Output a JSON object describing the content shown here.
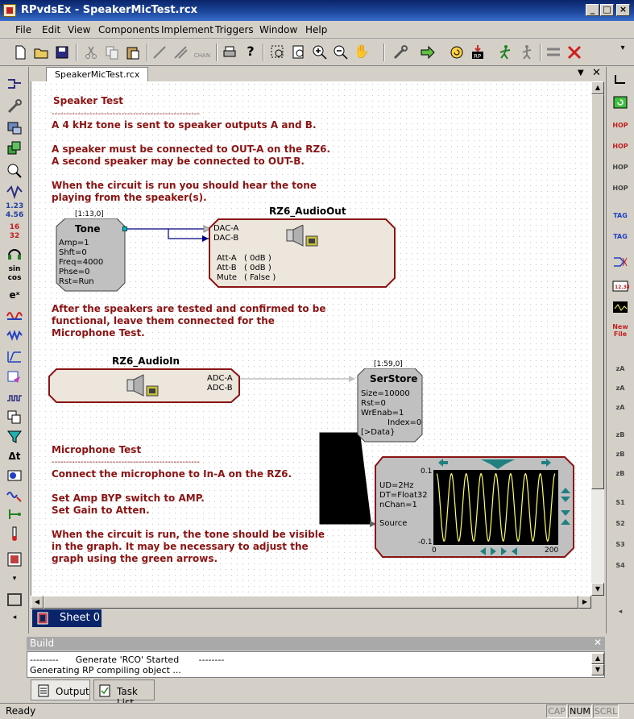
{
  "window": {
    "title": "RPvdsEx - SpeakerMicTest.rcx"
  },
  "menu": [
    "File",
    "Edit",
    "View",
    "Components",
    "Implement",
    "Triggers",
    "Window",
    "Help"
  ],
  "doc_tab": "SpeakerMicTest.rcx",
  "sheet_tab": "Sheet 0",
  "notes": {
    "speaker_title": "Speaker Test",
    "speaker_rule": "---------------------------------------------------",
    "speaker_l1": "A 4 kHz tone is sent to speaker outputs A and B.",
    "speaker_l2": "A speaker must be connected to OUT-A on the RZ6.",
    "speaker_l3": "A second speaker may be connected to OUT-B.",
    "speaker_l4": "When the circuit is run you should hear the tone",
    "speaker_l5": "playing from the speaker(s).",
    "after_l1": "After the speakers are tested and confirmed to be",
    "after_l2": "functional, leave them connected for the",
    "after_l3": "Microphone Test.",
    "mic_title": "Microphone Test",
    "mic_rule": "---------------------------------------------------",
    "mic_l1": "Connect the microphone to In-A on the RZ6.",
    "mic_l2": "Set Amp BYP switch  to AMP.",
    "mic_l3": "Set Gain to Atten.",
    "mic_l4": "When the circuit is run, the tone should be visible",
    "mic_l5": "in the graph. It may be necessary to adjust the",
    "mic_l6": "graph using the green arrows."
  },
  "tone": {
    "index": "[1:13,0]",
    "title": "Tone",
    "params": [
      "Amp=1",
      "Shft=0",
      "Freq=4000",
      "Phse=0",
      "Rst=Run"
    ]
  },
  "audio_out": {
    "title": "RZ6_AudioOut",
    "inputs": [
      "DAC-A",
      "DAC-B"
    ],
    "att_a": "Att-A",
    "att_a_val": "( 0dB )",
    "att_b": "Att-B",
    "att_b_val": "( 0dB )",
    "mute": "Mute",
    "mute_val": "( False )"
  },
  "audio_in": {
    "title": "RZ6_AudioIn",
    "outputs": [
      "ADC-A",
      "ADC-B"
    ]
  },
  "serstore": {
    "index": "[1:59,0]",
    "title": "SerStore",
    "params": [
      "Size=10000",
      "Rst=0",
      "WrEnab=1"
    ],
    "index_out": "Index=0",
    "data_in": "[>Data}"
  },
  "graph": {
    "params": [
      "UD=2Hz",
      "DT=Float32",
      "nChan=1"
    ],
    "source": "Source",
    "y_top": "0.1",
    "y_bottom": "-0.1",
    "x_left": "0",
    "x_right": "200"
  },
  "build": {
    "header": "Build",
    "lines": [
      "---------      Generate 'RCO' Started       --------",
      "Generating RP compiling object ..."
    ],
    "tabs": [
      "Output",
      "Task List"
    ]
  },
  "status": {
    "text": "Ready",
    "panels": [
      "CAP",
      "NUM",
      "SCRL"
    ]
  },
  "left_toolbar_labels": {
    "nums": "1.23\n4.56",
    "frac": "16\n32",
    "sincos": "sin\ncos",
    "exp": "eˣ",
    "delta": "Δt"
  },
  "chart_data": {
    "type": "line",
    "title": "",
    "xlabel": "",
    "ylabel": "",
    "xlim": [
      0,
      200
    ],
    "ylim": [
      -0.1,
      0.1
    ],
    "series": [
      {
        "cycles": 8,
        "amplitude": 0.09,
        "color": "#ffff66"
      }
    ],
    "background": "#000000"
  }
}
